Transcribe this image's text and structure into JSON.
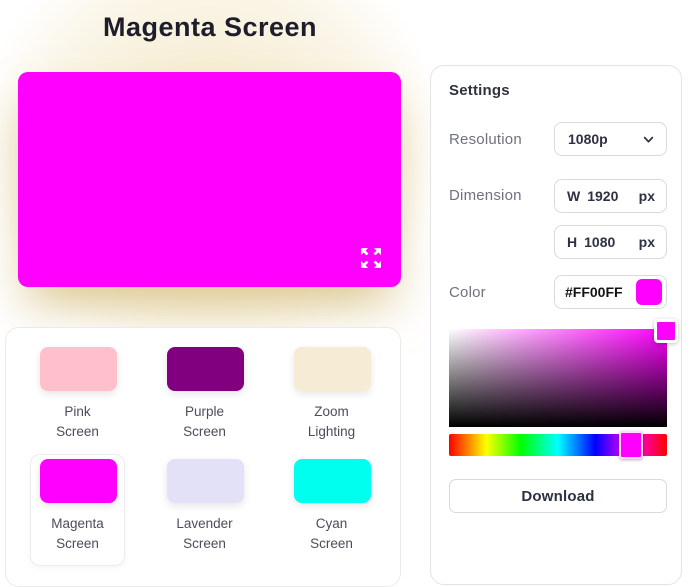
{
  "theme": {
    "accent": "#FF00FF"
  },
  "header": {
    "title": "Magenta Screen"
  },
  "preview": {
    "background": "#FF00FF",
    "fullscreen_icon": "expand-arrows-icon"
  },
  "presets": {
    "items": [
      {
        "lines": [
          "Pink",
          "Screen"
        ],
        "color": "#FFC0CB",
        "selected": false
      },
      {
        "lines": [
          "Purple",
          "Screen"
        ],
        "color": "#800080",
        "selected": false
      },
      {
        "lines": [
          "Zoom",
          "Lighting"
        ],
        "color": "#F6EBD5",
        "selected": false
      },
      {
        "lines": [
          "Magenta",
          "Screen"
        ],
        "color": "#FF00FF",
        "selected": true
      },
      {
        "lines": [
          "Lavender",
          "Screen"
        ],
        "color": "#E2E1F7",
        "selected": false
      },
      {
        "lines": [
          "Cyan",
          "Screen"
        ],
        "color": "#00FFEF",
        "selected": false
      }
    ]
  },
  "settings": {
    "heading": "Settings",
    "resolution_label": "Resolution",
    "resolution_value": "1080p",
    "dimension_label": "Dimension",
    "width_prefix": "W",
    "width_value": "1920",
    "height_prefix": "H",
    "height_value": "1080",
    "unit": "px",
    "color_label": "Color",
    "color_value": "#FF00FF",
    "picker": {
      "hue_position_pct": 83.3,
      "handle_color": "#FF00FF"
    },
    "download_label": "Download"
  }
}
